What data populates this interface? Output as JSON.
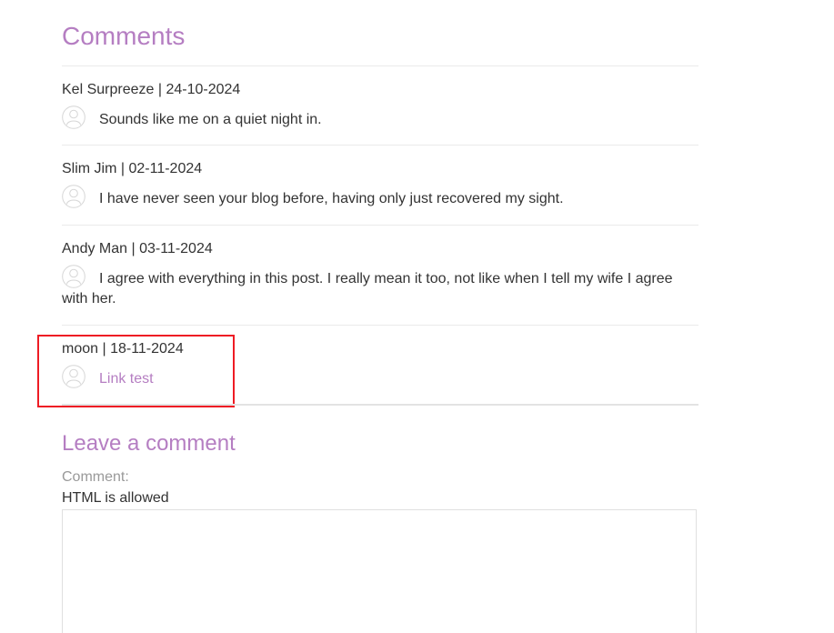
{
  "comments_section": {
    "title": "Comments",
    "items": [
      {
        "meta": "Kel Surpreeze | 24-10-2024",
        "avatar_icon": "user-avatar-icon",
        "text": "Sounds like me on a quiet night in."
      },
      {
        "meta": "Slim Jim | 02-11-2024",
        "avatar_icon": "user-avatar-icon",
        "text": "I have never seen your blog before, having only just recovered my sight."
      },
      {
        "meta": "Andy Man | 03-11-2024",
        "avatar_icon": "user-avatar-icon",
        "text": "I agree with everything in this post. I really mean it too, not like when I tell my wife I agree with her."
      },
      {
        "meta": "moon | 18-11-2024",
        "avatar_icon": "user-avatar-icon",
        "link_text": "Link test"
      }
    ]
  },
  "leave_comment": {
    "title": "Leave a comment",
    "comment_label": "Comment:",
    "html_note": "HTML is allowed",
    "comment_value": ""
  },
  "colors": {
    "accent": "#b57ec2",
    "highlight": "#ee1c24",
    "text": "#333333",
    "muted": "#999999",
    "divider": "#ebebeb"
  }
}
